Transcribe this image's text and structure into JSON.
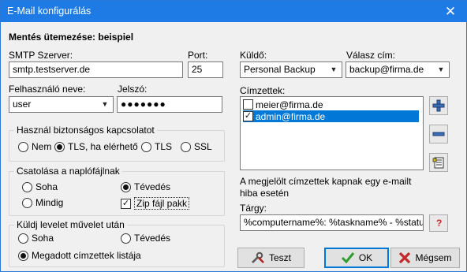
{
  "window": {
    "title": "E-Mail konfigurálás"
  },
  "schedule_heading": "Mentés ütemezése: beispiel",
  "smtp": {
    "label": "SMTP Szerver:",
    "value": "smtp.testserver.de"
  },
  "port": {
    "label": "Port:",
    "value": "25"
  },
  "username": {
    "label": "Felhasználó neve:",
    "value": "user"
  },
  "password": {
    "label": "Jelszó:",
    "value": "●●●●●●●"
  },
  "secure": {
    "legend": "Használ biztonságos kapcsolatot",
    "options": [
      "Nem",
      "TLS, ha elérhető",
      "TLS",
      "SSL"
    ],
    "selected": "TLS, ha elérhető"
  },
  "attach": {
    "legend": "Csatolása a naplófájlnak",
    "options": [
      "Soha",
      "Tévedés",
      "Mindig"
    ],
    "selected": "Tévedés",
    "zip_label": "Zip fájl pakk",
    "zip_checked": true
  },
  "send_after": {
    "legend": "Küldj levelet művelet után",
    "options": [
      "Soha",
      "Tévedés",
      "Megadott címzettek listája"
    ],
    "selected": "Megadott címzettek listája"
  },
  "sender": {
    "label": "Küldő:",
    "value": "Personal Backup"
  },
  "reply_to": {
    "label": "Válasz cím:",
    "value": "backup@firma.de"
  },
  "recipients": {
    "label": "Címzettek:",
    "items": [
      {
        "address": "meier@firma.de",
        "checked": false,
        "selected": false
      },
      {
        "address": "admin@firma.de",
        "checked": true,
        "selected": true
      }
    ]
  },
  "note": "A megjelölt címzettek kapnak egy e-mailt hiba esetén",
  "subject": {
    "label": "Tárgy:",
    "value": "%computername%: %taskname% - %status%"
  },
  "help_label": "?",
  "buttons": {
    "test": "Teszt",
    "ok": "OK",
    "cancel": "Mégsem"
  },
  "colors": {
    "titlebar": "#1e7be6",
    "selection": "#0078d7",
    "ok_check": "#2e9e2e",
    "cancel_x": "#c62828"
  }
}
